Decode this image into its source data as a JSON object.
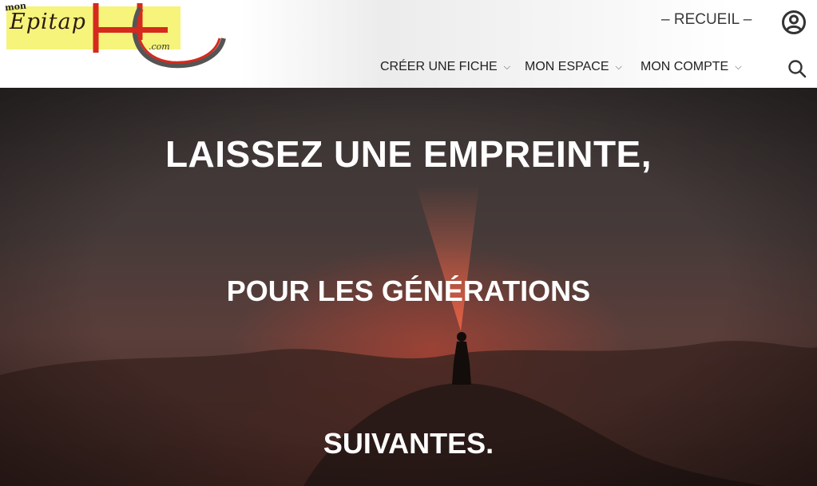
{
  "header": {
    "logo": {
      "small_text": "mon",
      "main_text": "Epitap",
      "suffix": ".com",
      "accent_color": "#d52a1e",
      "highlight_color": "#f6f47a"
    },
    "top_link": "– RECUEIL –",
    "account_icon": "account-circle-icon",
    "nav": [
      {
        "label": "CRÉER UNE FICHE",
        "icon": "chevron-down-icon"
      },
      {
        "label": "MON ESPACE",
        "icon": "chevron-down-icon"
      },
      {
        "label": "MON COMPTE",
        "icon": "chevron-down-icon"
      }
    ],
    "search_icon": "search-icon"
  },
  "hero": {
    "line1": "LAISSEZ UNE EMPREINTE,",
    "line2": "POUR LES GÉNÉRATIONS",
    "line3": "SUIVANTES."
  }
}
